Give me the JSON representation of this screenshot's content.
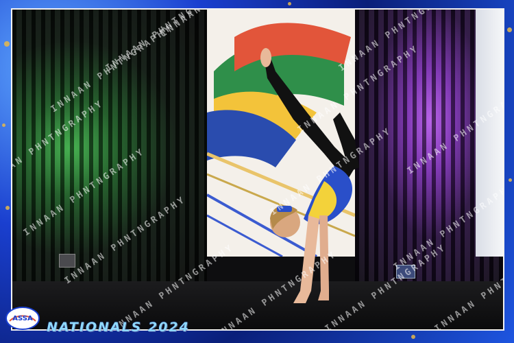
{
  "event": {
    "title": "NATIONALS 2024",
    "logo_text": "ASSA"
  },
  "watermark_text": "INNAAN PHNTNGRAPHY",
  "colors": {
    "frame_blue": "#1a3fcf",
    "gold_accent": "#e6b84a",
    "curtain_left_light": "#3fae4a",
    "curtain_right_light": "#9b3fd6",
    "costume_yellow": "#f3d23a",
    "costume_blue": "#2a4fc9"
  }
}
